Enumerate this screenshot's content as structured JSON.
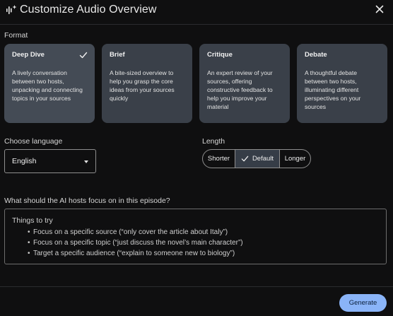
{
  "header": {
    "title": "Customize Audio Overview",
    "icon": "sparkle-waveform-icon",
    "close_icon": "close-icon"
  },
  "format": {
    "label": "Format",
    "cards": [
      {
        "title": "Deep Dive",
        "desc": "A lively conversation between two hosts, unpacking and connecting topics in your sources",
        "selected": true
      },
      {
        "title": "Brief",
        "desc": "A bite-sized overview to help you grasp the core ideas from your sources quickly",
        "selected": false
      },
      {
        "title": "Critique",
        "desc": "An expert review of your sources, offering constructive feedback to help you improve your material",
        "selected": false
      },
      {
        "title": "Debate",
        "desc": "A thoughtful debate between two hosts, illuminating different perspectives on your sources",
        "selected": false
      }
    ]
  },
  "language": {
    "label": "Choose language",
    "value": "English"
  },
  "length": {
    "label": "Length",
    "options": [
      "Shorter",
      "Default",
      "Longer"
    ],
    "selected": "Default"
  },
  "focus": {
    "label": "What should the AI hosts focus on in this episode?",
    "hint_title": "Things to try",
    "hints": [
      "Focus on a specific source (“only cover the article about Italy”)",
      "Focus on a specific topic (“just discuss the novel’s main character”)",
      "Target a specific audience (“explain to someone new to biology”)"
    ]
  },
  "actions": {
    "generate_label": "Generate"
  },
  "colors": {
    "background": "#0f0f10",
    "card": "#3a4049",
    "accent": "#8ab4f8"
  }
}
